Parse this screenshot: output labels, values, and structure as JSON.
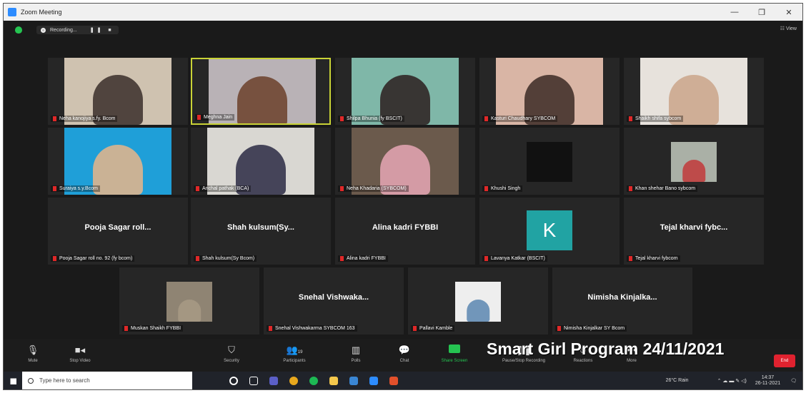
{
  "window": {
    "title": "Zoom Meeting",
    "minimize": "—",
    "maximize": "❐",
    "close": "✕"
  },
  "topbar": {
    "recording_label": "Recording...",
    "recording_controls": "❚❚ ■",
    "view_label": "☷ View"
  },
  "participants": [
    {
      "name": "Neha kanojiya s.fy. Bcom",
      "video": true,
      "bg": "#cfc2b0",
      "person": "#3a2e2a"
    },
    {
      "name": "Meghna Jain",
      "video": true,
      "bg": "#b9b2b6",
      "person": "#6b3f2a",
      "active": true
    },
    {
      "name": "Shilpa Bhunia (fy BSCIT)",
      "video": true,
      "bg": "#7fb7a8",
      "person": "#2c1f1f"
    },
    {
      "name": "Kasturi Chaudhary SYBCOM",
      "video": true,
      "bg": "#d9b5a5",
      "person": "#3b2a24"
    },
    {
      "name": "Shaikh shifa sybcom",
      "video": true,
      "bg": "#e7e2dc",
      "person": "#caa58a"
    },
    {
      "name": "Suraiya s.y.Bcom",
      "video": true,
      "bg": "#1f9fd8",
      "person": "#e9b58a"
    },
    {
      "name": "Anchal pathak (BCA)",
      "video": true,
      "bg": "#d9d7d2",
      "person": "#2a2a44"
    },
    {
      "name": "Neha Khadaria (SYBCOM)",
      "video": true,
      "bg": "#6b5a4c",
      "person": "#e6a7b5"
    },
    {
      "name": "Khushi Singh",
      "video": false,
      "black": true
    },
    {
      "name": "Khan shehar Bano sybcom",
      "video": true,
      "bg": "#aab0a6",
      "person": "#c23a3a",
      "small": true
    },
    {
      "name": "Pooja Sagar roll no. 92 (fy bcom)",
      "display": "Pooja Sagar roll...",
      "video": false
    },
    {
      "name": "Shah kulsum(Sy Bcom)",
      "display": "Shah kulsum(Sy...",
      "video": false
    },
    {
      "name": "Alina kadri FYBBI",
      "display": "Alina kadri FYBBI",
      "video": false
    },
    {
      "name": "Lavanya Katkar (BSCIT)",
      "video": false,
      "avatar": "K"
    },
    {
      "name": "Tejal kharvi fybcom",
      "display": "Tejal kharvi fybc...",
      "video": false
    },
    {
      "name": "Muskan Shaikh FYBBI",
      "video": true,
      "bg": "#8f8473",
      "person": "#a89a85",
      "small": true
    },
    {
      "name": "Snehal Vishwakarma SYBCOM 163",
      "display": "Snehal Vishwaka...",
      "video": false
    },
    {
      "name": "Pallavi Kamble",
      "video": true,
      "bg": "#eeeeee",
      "person": "#5a86b0",
      "small": true
    },
    {
      "name": "Nimisha Kinjalkar SY Bcom",
      "display": "Nimisha Kinjalka...",
      "video": false
    }
  ],
  "toolbar": {
    "mute": "Mute",
    "stop_video": "Stop Video",
    "security": "Security",
    "participants": "Participants",
    "participants_count": "19",
    "polls": "Polls",
    "chat": "Chat",
    "share_screen": "Share Screen",
    "pause_stop_recording": "Pause/Stop Recording",
    "reactions": "Reactions",
    "more": "More",
    "end": "End"
  },
  "overlay_text": "Smart Girl Program 24/11/2021",
  "taskbar": {
    "search_placeholder": "Type here to search",
    "weather": "26°C Rain",
    "time": "14:37",
    "date": "26-11-2021"
  }
}
